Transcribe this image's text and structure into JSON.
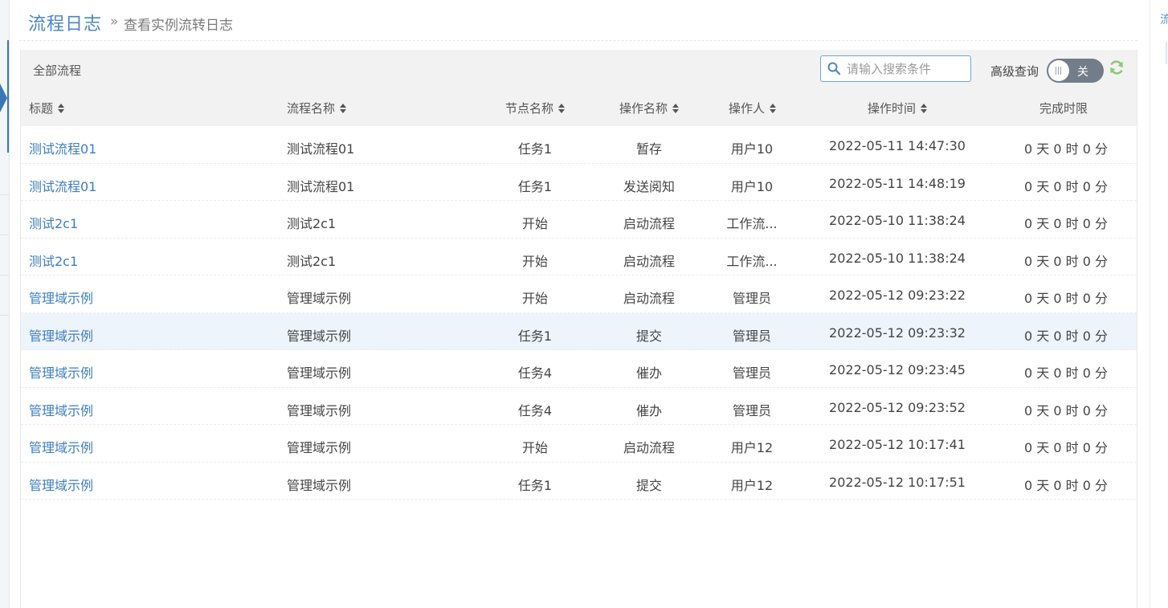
{
  "header": {
    "title": "流程日志",
    "arrow": "»",
    "subtitle": "查看实例流转日志"
  },
  "right_panel": {
    "tab_label": "流"
  },
  "toolbar": {
    "title": "全部流程",
    "search_placeholder": "请输入搜索条件",
    "advanced_label": "高级查询",
    "toggle_state": "关"
  },
  "table": {
    "columns": [
      "标题",
      "流程名称",
      "节点名称",
      "操作名称",
      "操作人",
      "操作时间",
      "完成时限"
    ],
    "rows": [
      {
        "title": "测试流程01",
        "process": "测试流程01",
        "node": "任务1",
        "action": "暂存",
        "operator": "用户10",
        "time": "2022-05-11 14:47:30",
        "limit": "0 天 0 时 0 分"
      },
      {
        "title": "测试流程01",
        "process": "测试流程01",
        "node": "任务1",
        "action": "发送阅知",
        "operator": "用户10",
        "time": "2022-05-11 14:48:19",
        "limit": "0 天 0 时 0 分"
      },
      {
        "title": "测试2c1",
        "process": "测试2c1",
        "node": "开始",
        "action": "启动流程",
        "operator": "工作流...",
        "time": "2022-05-10 11:38:24",
        "limit": "0 天 0 时 0 分"
      },
      {
        "title": "测试2c1",
        "process": "测试2c1",
        "node": "开始",
        "action": "启动流程",
        "operator": "工作流...",
        "time": "2022-05-10 11:38:24",
        "limit": "0 天 0 时 0 分"
      },
      {
        "title": "管理域示例",
        "process": "管理域示例",
        "node": "开始",
        "action": "启动流程",
        "operator": "管理员",
        "time": "2022-05-12 09:23:22",
        "limit": "0 天 0 时 0 分"
      },
      {
        "title": "管理域示例",
        "process": "管理域示例",
        "node": "任务1",
        "action": "提交",
        "operator": "管理员",
        "time": "2022-05-12 09:23:32",
        "limit": "0 天 0 时 0 分"
      },
      {
        "title": "管理域示例",
        "process": "管理域示例",
        "node": "任务4",
        "action": "催办",
        "operator": "管理员",
        "time": "2022-05-12 09:23:45",
        "limit": "0 天 0 时 0 分"
      },
      {
        "title": "管理域示例",
        "process": "管理域示例",
        "node": "任务4",
        "action": "催办",
        "operator": "管理员",
        "time": "2022-05-12 09:23:52",
        "limit": "0 天 0 时 0 分"
      },
      {
        "title": "管理域示例",
        "process": "管理域示例",
        "node": "开始",
        "action": "启动流程",
        "operator": "用户12",
        "time": "2022-05-12 10:17:41",
        "limit": "0 天 0 时 0 分"
      },
      {
        "title": "管理域示例",
        "process": "管理域示例",
        "node": "任务1",
        "action": "提交",
        "operator": "用户12",
        "time": "2022-05-12 10:17:51",
        "limit": "0 天 0 时 0 分"
      }
    ]
  },
  "colors": {
    "accent": "#4a86bf",
    "link": "#3d7dbd",
    "refresh": "#8cc87a",
    "toggle_bg": "#737d89"
  },
  "icons": {
    "search": "search-icon",
    "refresh": "refresh-icon",
    "collapse": "collapse-arrow-icon"
  }
}
